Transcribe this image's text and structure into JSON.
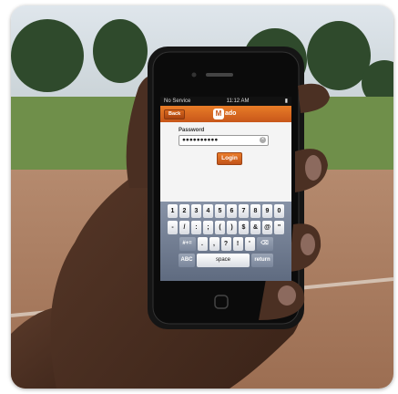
{
  "phone": {
    "status": {
      "carrier": "No Service",
      "time": "11:12 AM"
    },
    "nav": {
      "back_label": "Back",
      "logo_mark": "M",
      "logo_text": "ado"
    },
    "form": {
      "password_label": "Password",
      "password_value": "●●●●●●●●●●",
      "login_label": "Login"
    },
    "keyboard": {
      "row1": [
        "1",
        "2",
        "3",
        "4",
        "5",
        "6",
        "7",
        "8",
        "9",
        "0"
      ],
      "row2": [
        "-",
        "/",
        ":",
        ";",
        "(",
        ")",
        "$",
        "&",
        "@",
        "\""
      ],
      "row3": [
        "#+=",
        ".",
        ",",
        "?",
        "!",
        "'",
        "⌫"
      ],
      "row4": [
        "ABC",
        "space",
        "return"
      ]
    }
  }
}
